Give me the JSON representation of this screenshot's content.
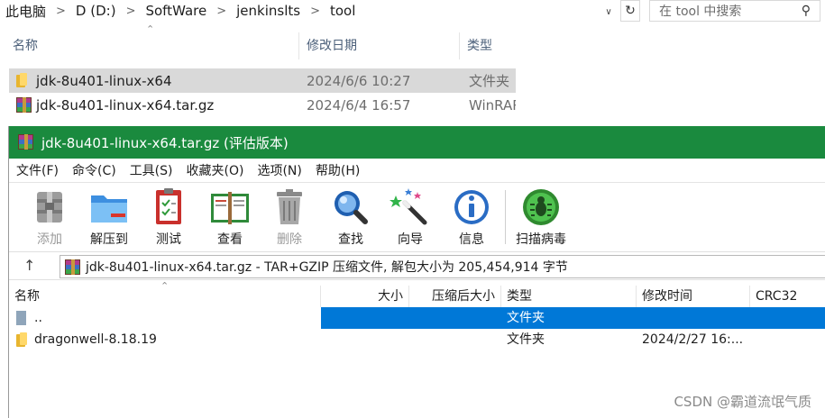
{
  "explorer": {
    "breadcrumbs": [
      "此电脑",
      "D (D:)",
      "SoftWare",
      "jenkinslts",
      "tool"
    ],
    "search_placeholder": "在 tool 中搜索",
    "columns": {
      "name": "名称",
      "date": "修改日期",
      "type": "类型"
    },
    "rows": [
      {
        "name": "jdk-8u401-linux-x64",
        "date": "2024/6/6 10:27",
        "type": "文件夹",
        "icon": "folder-icon"
      },
      {
        "name": "jdk-8u401-linux-x64.tar.gz",
        "date": "2024/6/4 16:57",
        "type": "WinRAR",
        "icon": "rar-archive-icon"
      }
    ]
  },
  "winrar": {
    "title": "jdk-8u401-linux-x64.tar.gz (评估版本)",
    "menu": [
      "文件(F)",
      "命令(C)",
      "工具(S)",
      "收藏夹(O)",
      "选项(N)",
      "帮助(H)"
    ],
    "toolbar": [
      {
        "label": "添加",
        "icon": "add-archive-icon",
        "enabled": false
      },
      {
        "label": "解压到",
        "icon": "extract-to-folder-icon",
        "enabled": true
      },
      {
        "label": "测试",
        "icon": "test-clipboard-icon",
        "enabled": true
      },
      {
        "label": "查看",
        "icon": "view-book-icon",
        "enabled": true
      },
      {
        "label": "删除",
        "icon": "trash-can-icon",
        "enabled": false
      },
      {
        "label": "查找",
        "icon": "magnifier-icon",
        "enabled": true
      },
      {
        "label": "向导",
        "icon": "wizard-wand-icon",
        "enabled": true
      },
      {
        "label": "信息",
        "icon": "info-icon",
        "enabled": true
      },
      {
        "label": "扫描病毒",
        "icon": "virus-scan-icon",
        "enabled": true
      }
    ],
    "path_text": "jdk-8u401-linux-x64.tar.gz - TAR+GZIP 压缩文件, 解包大小为 205,454,914 字节",
    "columns": {
      "name": "名称",
      "size": "大小",
      "packed": "压缩后大小",
      "type": "类型",
      "modified": "修改时间",
      "crc": "CRC32"
    },
    "rows": [
      {
        "name": "..",
        "size": "",
        "packed": "",
        "type": "文件夹",
        "modified": "",
        "crc": "",
        "icon": "parent-folder-icon",
        "selected": true
      },
      {
        "name": "dragonwell-8.18.19",
        "size": "",
        "packed": "",
        "type": "文件夹",
        "modified": "2024/2/27 16:...",
        "crc": "",
        "icon": "folder-icon",
        "selected": false
      }
    ]
  },
  "watermark": "CSDN @霸道流氓气质",
  "colors": {
    "titlebar": "#1a8a3e",
    "selection": "#0078d7",
    "explorer_selection": "#d9d9d9"
  }
}
